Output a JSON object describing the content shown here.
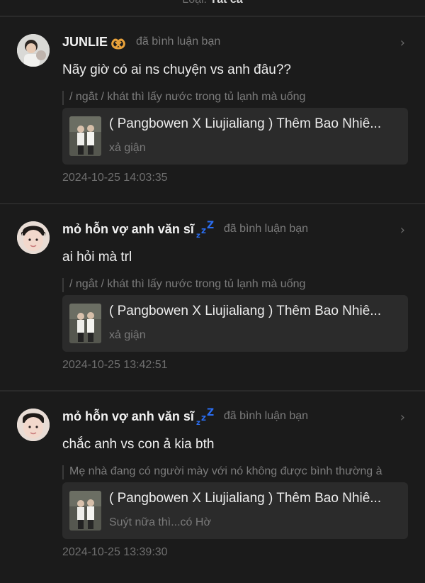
{
  "header": {
    "filter_prefix": "Loại:",
    "filter_value": "Tất cả"
  },
  "entries": [
    {
      "username": "JUNLIE",
      "badge_icon": "pretzel-icon",
      "action": "đã bình luận bạn",
      "comment": "Nãy giờ có ai ns chuyện vs anh đâu??",
      "quote": "/ ngắt / khát thì lấy nước trong tủ lạnh mà uống",
      "post_title": "( Pangbowen X Liujialiang ) Thêm Bao Nhiê...",
      "post_subtitle": "xả giận",
      "timestamp": "2024-10-25 14:03:35"
    },
    {
      "username": "mỏ hỗn vợ anh văn sĩ",
      "badge_icon": "sleeping-zzz-icon",
      "action": "đã bình luận bạn",
      "comment": "ai hỏi mà trl",
      "quote": "/ ngắt / khát thì lấy nước trong tủ lạnh mà uống",
      "post_title": "( Pangbowen X Liujialiang ) Thêm Bao Nhiê...",
      "post_subtitle": "xả giận",
      "timestamp": "2024-10-25 13:42:51"
    },
    {
      "username": "mỏ hỗn vợ anh văn sĩ",
      "badge_icon": "sleeping-zzz-icon",
      "action": "đã bình luận bạn",
      "comment": "chắc anh vs con ả kia bth",
      "quote": "Mẹ nhà đang có người mày với nó không được bình thường à",
      "post_title": "( Pangbowen X Liujialiang ) Thêm Bao Nhiê...",
      "post_subtitle": "Suýt nữa thì...có Hờ",
      "timestamp": "2024-10-25 13:39:30"
    }
  ],
  "colors": {
    "background": "#1b1b1b",
    "card": "#2b2b2b",
    "zzz_badge": "#2a6df0",
    "pretzel_badge": "#e9a23b"
  }
}
